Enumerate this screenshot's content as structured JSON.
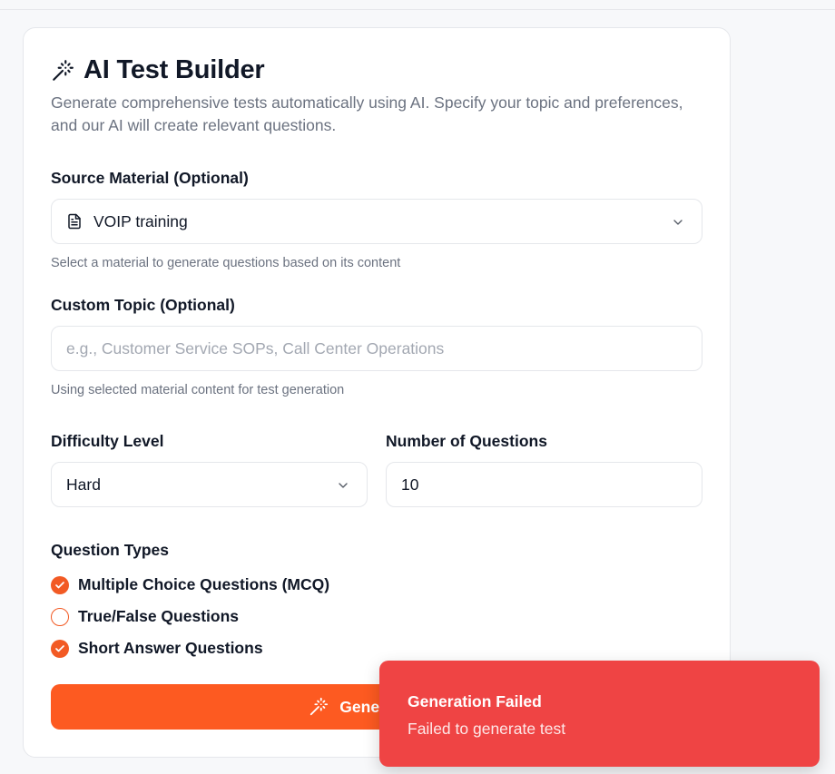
{
  "builder": {
    "title": "AI Test Builder",
    "subtitle": "Generate comprehensive tests automatically using AI. Specify your topic and preferences, and our AI will create relevant questions."
  },
  "source_material": {
    "label": "Source Material (Optional)",
    "selected_value": "VOIP training",
    "hint": "Select a material to generate questions based on its content"
  },
  "custom_topic": {
    "label": "Custom Topic (Optional)",
    "placeholder": "e.g., Customer Service SOPs, Call Center Operations",
    "value": "",
    "hint": "Using selected material content for test generation"
  },
  "difficulty": {
    "label": "Difficulty Level",
    "selected_value": "Hard"
  },
  "num_questions": {
    "label": "Number of Questions",
    "value": "10"
  },
  "question_types": {
    "label": "Question Types",
    "items": [
      {
        "label": "Multiple Choice Questions (MCQ)",
        "checked": true
      },
      {
        "label": "True/False Questions",
        "checked": false
      },
      {
        "label": "Short Answer Questions",
        "checked": true
      }
    ]
  },
  "generate_button": {
    "label": "Generate Test"
  },
  "toast": {
    "title": "Generation Failed",
    "description": "Failed to generate test"
  },
  "colors": {
    "accent": "#fd5a21",
    "toast_bg": "#ef4444",
    "text": "#111827",
    "muted": "#6b7280"
  }
}
